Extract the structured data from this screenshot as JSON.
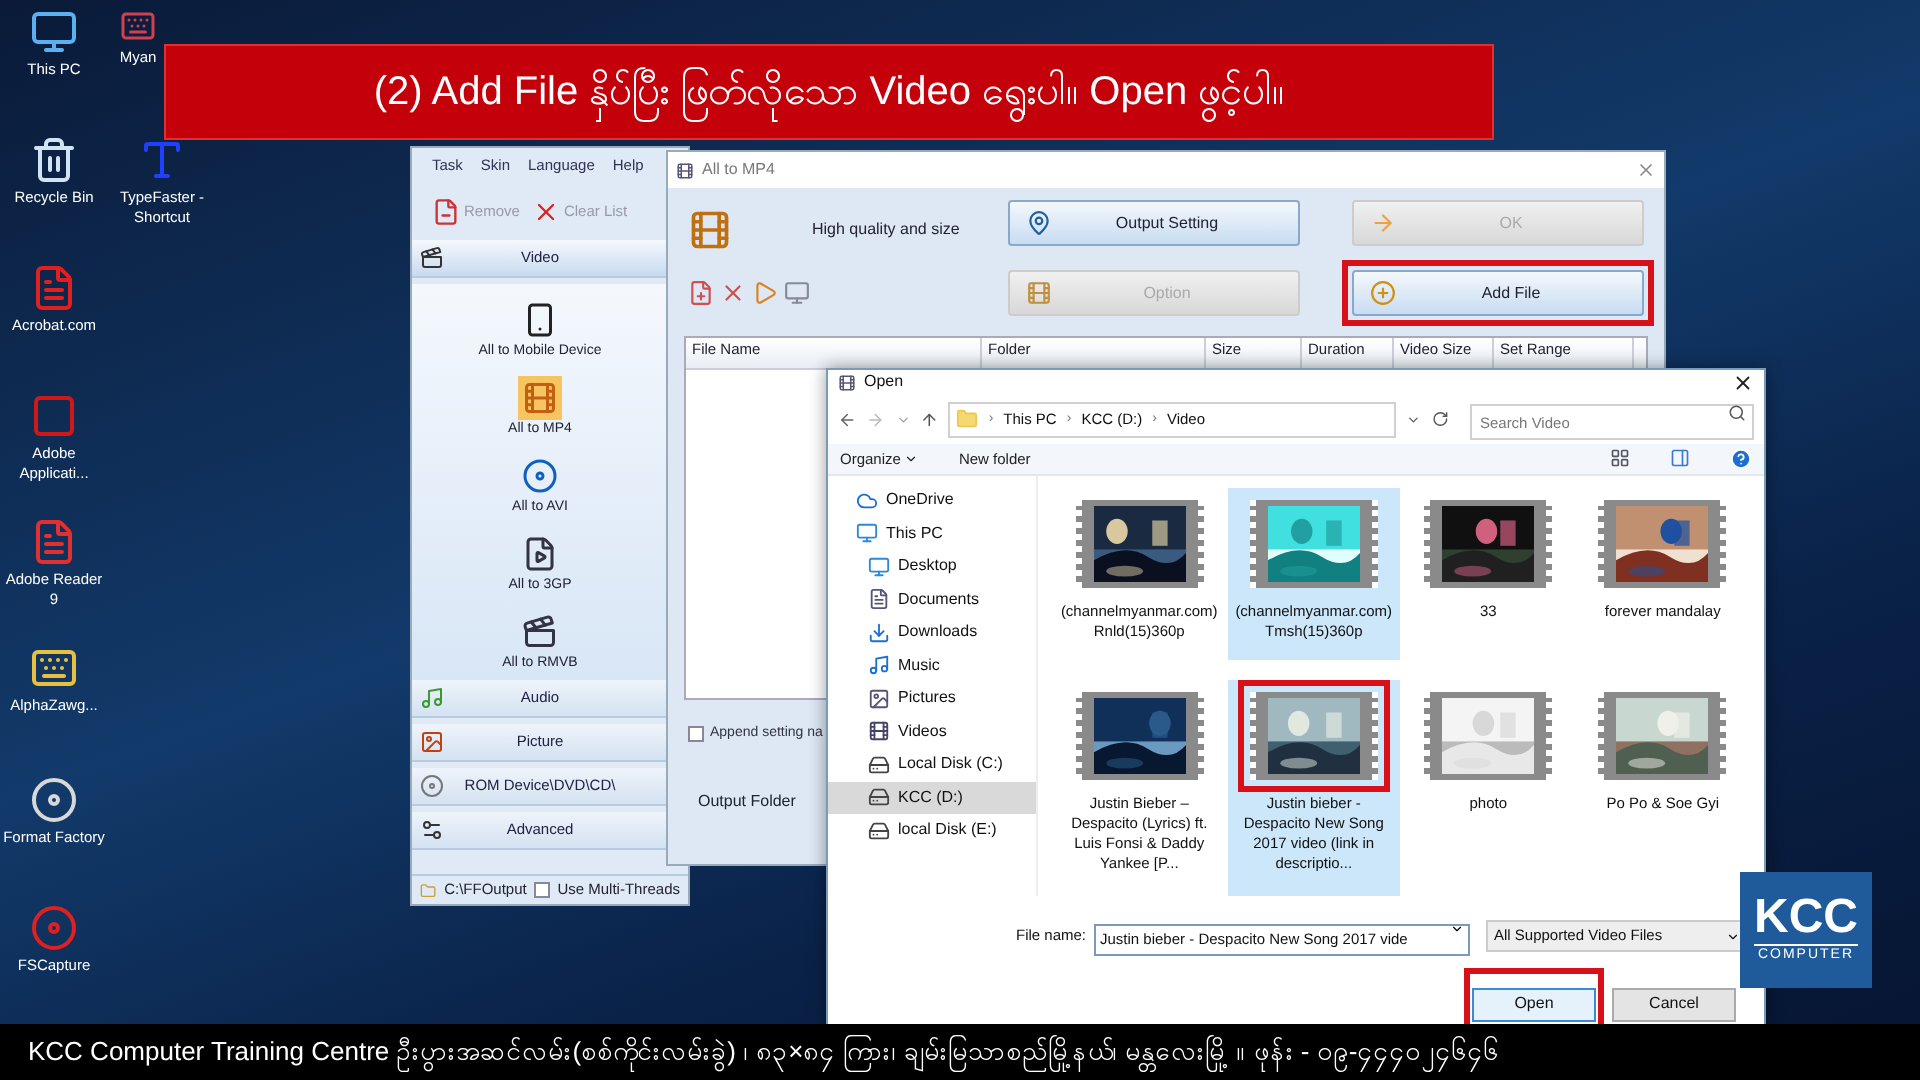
{
  "banner": {
    "text": "(2) Add File နှိပ်ပြီး ဖြတ်လိုသော Video ရွေးပါ။ Open ဖွင့်ပါ။"
  },
  "desktop_icons": [
    {
      "label": "This PC",
      "kind": "pc"
    },
    {
      "label": "Recycle Bin",
      "kind": "recycle"
    },
    {
      "label": "Acrobat.com",
      "kind": "acrobat"
    },
    {
      "label": "Adobe Applicati...",
      "kind": "adobe"
    },
    {
      "label": "Adobe Reader 9",
      "kind": "reader"
    },
    {
      "label": "AlphaZawg...",
      "kind": "keyboard"
    },
    {
      "label": "Format Factory",
      "kind": "factory"
    },
    {
      "label": "FSCapture",
      "kind": "capture"
    },
    {
      "label": "Myan",
      "kind": "typing"
    },
    {
      "label": "TypeFaster - Shortcut",
      "kind": "type"
    }
  ],
  "format_factory": {
    "menu": [
      "Task",
      "Skin",
      "Language",
      "Help"
    ],
    "toolbar": [
      {
        "label": "Remove",
        "kind": "remove",
        "disabled": true
      },
      {
        "label": "Clear List",
        "kind": "clear",
        "disabled": true
      }
    ],
    "sections": [
      {
        "label": "Video",
        "kind": "video",
        "expanded": true,
        "items": [
          {
            "label": "All to Mobile Device",
            "kind": "mobile",
            "selected": false
          },
          {
            "label": "All to MP4",
            "kind": "mp4",
            "selected": true
          },
          {
            "label": "All to AVI",
            "kind": "avi",
            "selected": false
          },
          {
            "label": "All to 3GP",
            "kind": "threegp",
            "selected": false
          },
          {
            "label": "All to RMVB",
            "kind": "rmvb",
            "selected": false
          }
        ]
      },
      {
        "label": "Audio",
        "kind": "audio",
        "expanded": false
      },
      {
        "label": "Picture",
        "kind": "picture",
        "expanded": false
      },
      {
        "label": "ROM Device\\DVD\\CD\\",
        "kind": "rom",
        "expanded": false
      },
      {
        "label": "Advanced",
        "kind": "advanced",
        "expanded": false
      }
    ],
    "status": {
      "path": "C:\\FFOutput",
      "option": "Use Multi-Threads",
      "checked": false
    }
  },
  "converter": {
    "title": "All to MP4",
    "quality": "High quality and size",
    "buttons": [
      {
        "label": "Output Setting",
        "kind": "setting",
        "disabled": false,
        "highlighted": false
      },
      {
        "label": "OK",
        "kind": "ok",
        "disabled": true,
        "highlighted": false
      },
      {
        "label": "Option",
        "kind": "option",
        "disabled": true,
        "highlighted": false
      },
      {
        "label": "Add File",
        "kind": "add",
        "disabled": false,
        "highlighted": true
      }
    ],
    "columns": [
      "File Name",
      "Folder",
      "Size",
      "Duration",
      "Video Size",
      "Set Range"
    ],
    "append_option": {
      "label": "Append setting na",
      "checked": false
    },
    "output_folder_label": "Output Folder"
  },
  "open_dialog": {
    "title": "Open",
    "path": [
      "This PC",
      "KCC (D:)",
      "Video"
    ],
    "path_separator": "›",
    "search": {
      "placeholder": "Search Video"
    },
    "toolbar": [
      "Organize",
      "New folder"
    ],
    "nav": [
      {
        "label": "OneDrive",
        "kind": "cloud",
        "selected": false
      },
      {
        "label": "This PC",
        "kind": "pc",
        "selected": false,
        "children": [
          {
            "label": "Desktop",
            "kind": "desktop",
            "selected": false
          },
          {
            "label": "Documents",
            "kind": "documents",
            "selected": false
          },
          {
            "label": "Downloads",
            "kind": "downloads",
            "selected": false
          },
          {
            "label": "Music",
            "kind": "music",
            "selected": false
          },
          {
            "label": "Pictures",
            "kind": "pictures",
            "selected": false
          },
          {
            "label": "Videos",
            "kind": "videos",
            "selected": false
          },
          {
            "label": "Local Disk (C:)",
            "kind": "disk",
            "selected": false
          },
          {
            "label": "KCC (D:)",
            "kind": "disk",
            "selected": true
          },
          {
            "label": "local Disk (E:)",
            "kind": "disk",
            "selected": false
          }
        ]
      }
    ],
    "files": [
      {
        "name": "(channelmyanmar.com)Rnld(15)360p",
        "selected": false,
        "highlighted": false
      },
      {
        "name": "(channelmyanmar.com)Tmsh(15)360p",
        "selected": true,
        "highlighted": false
      },
      {
        "name": "33",
        "selected": false,
        "highlighted": false
      },
      {
        "name": "forever mandalay",
        "selected": false,
        "highlighted": false
      },
      {
        "name": "Justin Bieber – Despacito (Lyrics) ft. Luis Fonsi & Daddy Yankee [P...",
        "selected": false,
        "highlighted": false
      },
      {
        "name": "Justin bieber - Despacito New Song 2017 video (link in descriptio...",
        "selected": true,
        "highlighted": true
      },
      {
        "name": "photo",
        "selected": false,
        "highlighted": false
      },
      {
        "name": "Po Po & Soe Gyi",
        "selected": false,
        "highlighted": false
      }
    ],
    "file_name_label": "File name:",
    "file_name": "Justin bieber - Despacito New Song 2017 vide",
    "filter": "All Supported Video Files",
    "buttons": [
      {
        "label": "Open",
        "highlighted": true
      },
      {
        "label": "Cancel",
        "highlighted": false
      }
    ]
  },
  "logo": {
    "name": "KCC",
    "tagline": "COMPUTER"
  },
  "footer": {
    "text": "KCC Computer Training Centre ဦးပွားအဆင်လမ်း(စစ်ကိုင်းလမ်းခွဲ) ၊ ၈၃×၈၄ ကြား၊ ချမ်းမြသာစည်မြို့နယ်၊ မန္တလေးမြို့ ။ ဖုန်း -  ၀၉-၄၄၄၀၂၄၆၄၆"
  }
}
